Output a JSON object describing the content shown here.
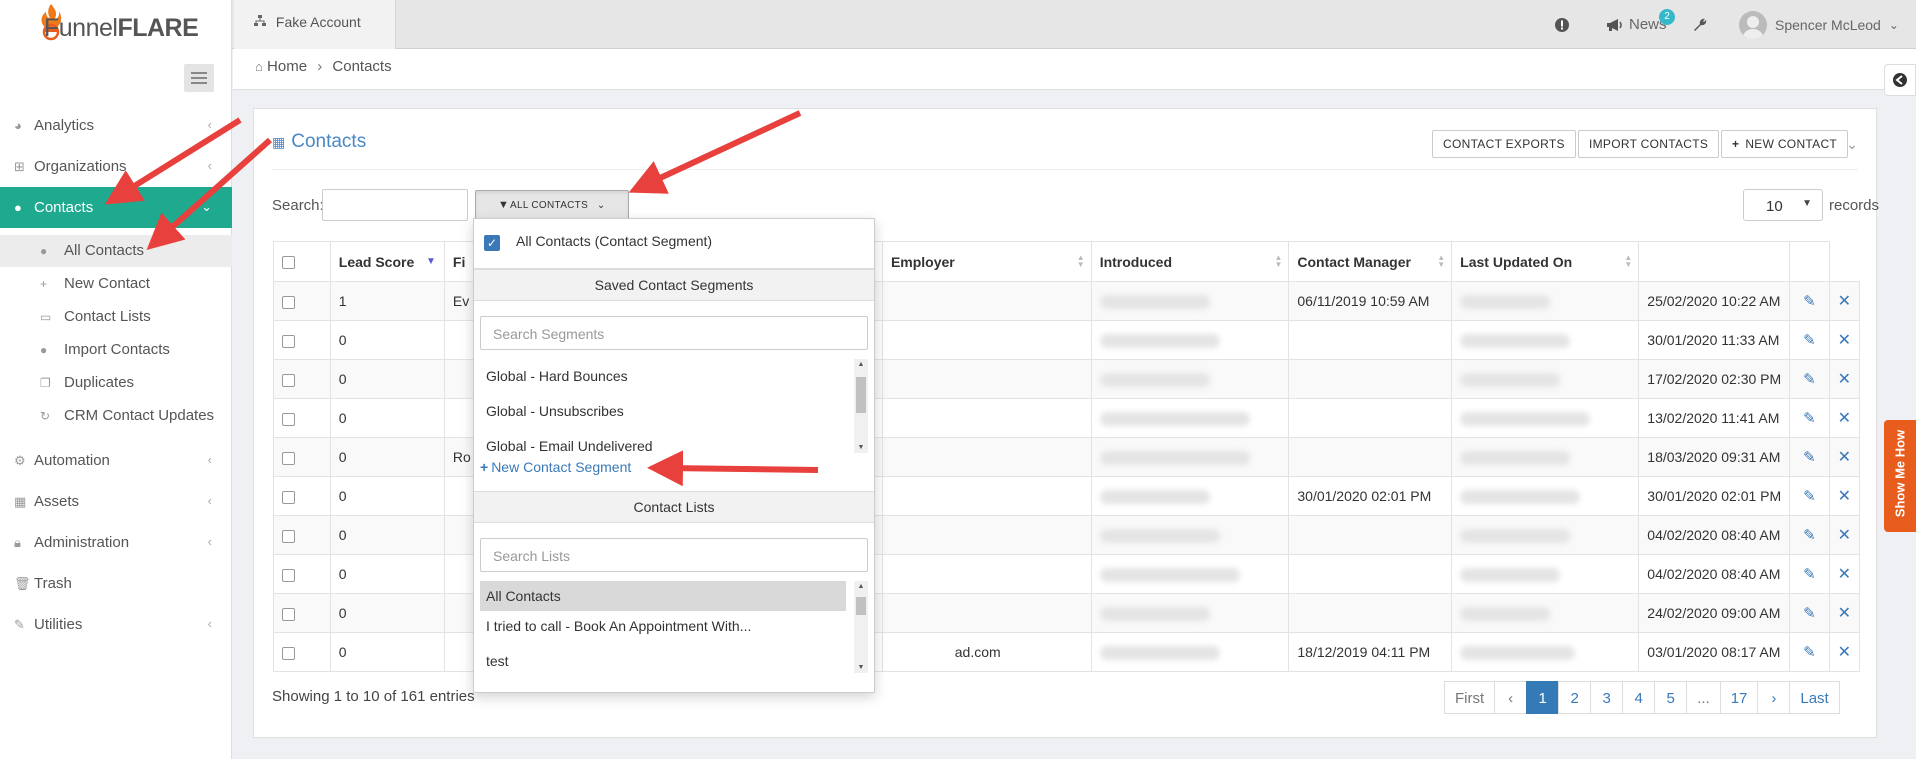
{
  "brand": {
    "name_light": "Funnel",
    "name_bold": "FLARE"
  },
  "account": {
    "label": "Fake Account"
  },
  "topbar": {
    "news_label": "News",
    "news_count": "2",
    "user_name": "Spencer McLeod",
    "caret": "⌄"
  },
  "sidebar": {
    "items": [
      {
        "label": "Analytics",
        "icon": "dashboard-icon"
      },
      {
        "label": "Organizations",
        "icon": "sitemap-icon"
      },
      {
        "label": "Contacts",
        "icon": "users-icon"
      },
      {
        "label": "Automation",
        "icon": "gears-icon"
      },
      {
        "label": "Assets",
        "icon": "grid-icon"
      },
      {
        "label": "Administration",
        "icon": "lock-icon"
      },
      {
        "label": "Trash",
        "icon": "trash-icon"
      },
      {
        "label": "Utilities",
        "icon": "wrench-icon"
      }
    ],
    "sub_items": [
      {
        "label": "All Contacts"
      },
      {
        "label": "New Contact"
      },
      {
        "label": "Contact Lists"
      },
      {
        "label": "Import Contacts"
      },
      {
        "label": "Duplicates"
      },
      {
        "label": "CRM Contact Updates"
      }
    ]
  },
  "breadcrumb": {
    "home": "Home",
    "current": "Contacts"
  },
  "page": {
    "title": "Contacts",
    "buttons": {
      "exports": "CONTACT EXPORTS",
      "import": "IMPORT CONTACTS",
      "new": "NEW CONTACT"
    },
    "search_label": "Search:",
    "filter_label": "ALL CONTACTS",
    "records_value": "10",
    "records_label": "records",
    "showing": "Showing 1 to 10 of 161 entries"
  },
  "table": {
    "headers": [
      "Lead Score",
      "Fi",
      "Employer",
      "Introduced",
      "Contact Manager",
      "Last Updated On"
    ],
    "rows": [
      {
        "score": "1",
        "first": "Ev",
        "email_tail": "",
        "introduced": "06/11/2019 10:59 AM",
        "updated": "25/02/2020 10:22 AM"
      },
      {
        "score": "0",
        "first": "",
        "email_tail": "",
        "introduced": "",
        "updated": "30/01/2020 11:33 AM"
      },
      {
        "score": "0",
        "first": "",
        "email_tail": "",
        "introduced": "",
        "updated": "17/02/2020 02:30 PM"
      },
      {
        "score": "0",
        "first": "",
        "email_tail": "",
        "introduced": "",
        "updated": "13/02/2020 11:41 AM"
      },
      {
        "score": "0",
        "first": "Ro",
        "email_tail": "",
        "introduced": "",
        "updated": "18/03/2020 09:31 AM"
      },
      {
        "score": "0",
        "first": "",
        "email_tail": "",
        "introduced": "30/01/2020 02:01 PM",
        "updated": "30/01/2020 02:01 PM"
      },
      {
        "score": "0",
        "first": "",
        "email_tail": "",
        "introduced": "",
        "updated": "04/02/2020 08:40 AM"
      },
      {
        "score": "0",
        "first": "",
        "email_tail": "",
        "introduced": "",
        "updated": "04/02/2020 08:40 AM"
      },
      {
        "score": "0",
        "first": "",
        "email_tail": "",
        "introduced": "",
        "updated": "24/02/2020 09:00 AM"
      },
      {
        "score": "0",
        "first": "",
        "email_tail": "ad.com",
        "introduced": "18/12/2019 04:11 PM",
        "updated": "03/01/2020 08:17 AM"
      }
    ]
  },
  "pagination": {
    "first": "First",
    "prev": "‹",
    "pages": [
      "1",
      "2",
      "3",
      "4",
      "5",
      "...",
      "17"
    ],
    "next": "›",
    "last": "Last"
  },
  "dropdown": {
    "all_contacts": "All Contacts (Contact Segment)",
    "segments_header": "Saved Contact Segments",
    "segments_search_placeholder": "Search Segments",
    "segments": [
      "Global - Hard Bounces",
      "Global - Unsubscribes",
      "Global - Email Undelivered"
    ],
    "new_segment": "New Contact Segment",
    "lists_header": "Contact Lists",
    "lists_search_placeholder": "Search Lists",
    "lists": [
      "All Contacts",
      "I tried to call - Book An Appointment With...",
      "test"
    ]
  },
  "show_me_how": "Show Me How",
  "colors": {
    "accent": "#1faa8f",
    "link": "#3a7ab8",
    "annotation": "#e8403c",
    "show_me": "#e85d1e"
  }
}
